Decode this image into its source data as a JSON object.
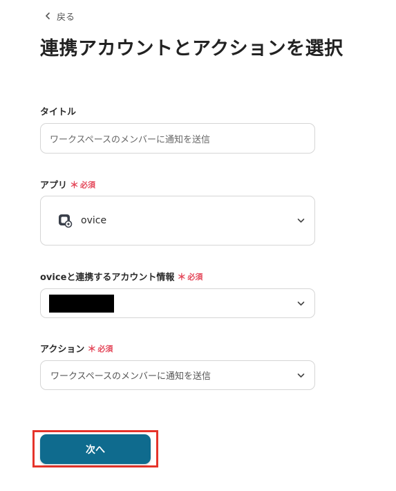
{
  "header": {
    "back_label": "戻る",
    "page_title": "連携アカウントとアクションを選択"
  },
  "form": {
    "title_field": {
      "label": "タイトル",
      "value": "ワークスペースのメンバーに通知を送信"
    },
    "app_field": {
      "label": "アプリ",
      "required_mark": "＊",
      "required_text": "必須",
      "selected_app": "ovice",
      "icon": "ovice-logo-icon"
    },
    "account_field": {
      "label": "oviceと連携するアカウント情報",
      "required_mark": "＊",
      "required_text": "必須"
    },
    "action_field": {
      "label": "アクション",
      "required_mark": "＊",
      "required_text": "必須",
      "selected": "ワークスペースのメンバーに通知を送信"
    }
  },
  "footer": {
    "next_label": "次へ"
  },
  "colors": {
    "primary_button": "#0f6b8e",
    "required": "#e4485a",
    "highlight_frame": "#e5332a"
  }
}
